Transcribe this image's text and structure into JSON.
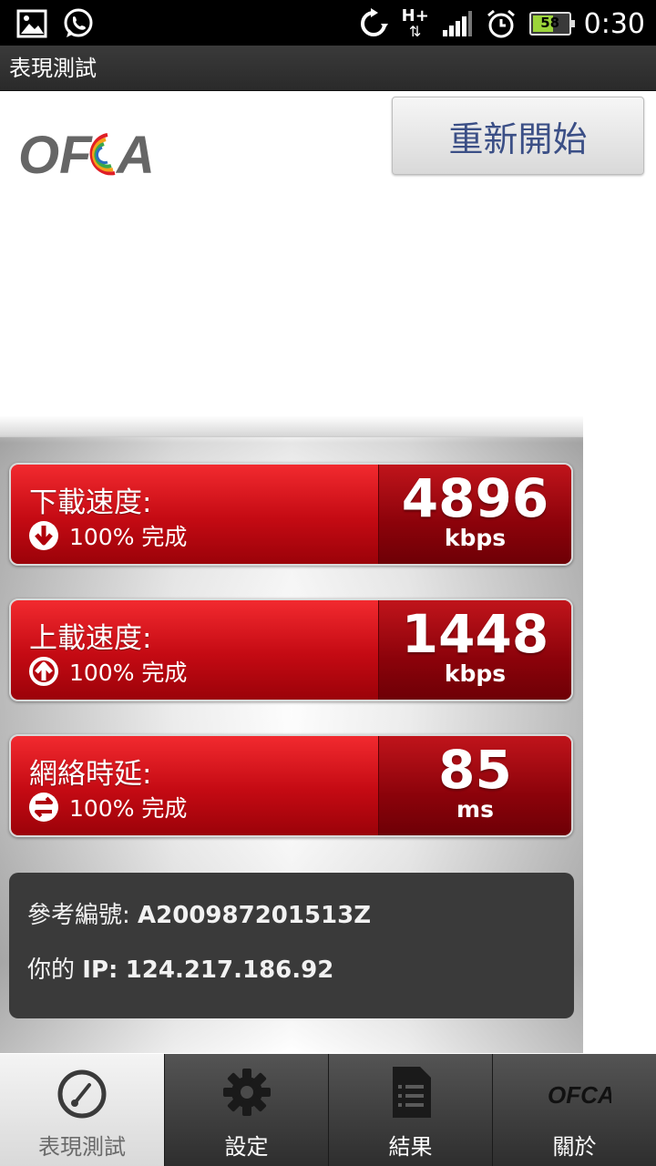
{
  "status_bar": {
    "network_type": "H+",
    "battery_level": "58",
    "battery_fraction": 0.58,
    "time": "0:30"
  },
  "title_bar": {
    "title": "表現測試"
  },
  "header": {
    "logo_text": "OFCA",
    "restart_label": "重新開始"
  },
  "metrics": [
    {
      "label": "下載速度:",
      "status": "100% 完成",
      "value": "4896",
      "unit": "kbps",
      "icon": "download-arrow-icon"
    },
    {
      "label": "上載速度:",
      "status": "100% 完成",
      "value": "1448",
      "unit": "kbps",
      "icon": "upload-arrow-icon"
    },
    {
      "label": "網絡時延:",
      "status": "100% 完成",
      "value": "85",
      "unit": "ms",
      "icon": "latency-exchange-icon"
    }
  ],
  "info": {
    "ref_label": "參考編號:",
    "ref_value": "A200987201513Z",
    "ip_label": "你的",
    "ip_key": "IP:",
    "ip_value": "124.217.186.92"
  },
  "tabs": [
    {
      "label": "表現測試",
      "icon": "speedometer-icon",
      "active": true
    },
    {
      "label": "設定",
      "icon": "gear-icon",
      "active": false
    },
    {
      "label": "結果",
      "icon": "document-list-icon",
      "active": false
    },
    {
      "label": "關於",
      "icon": "ofca-logo-icon",
      "active": false
    }
  ],
  "colors": {
    "metric_red": "#d0121a",
    "metric_dark_red": "#7a0008",
    "restart_text": "#3b4f86",
    "info_bg": "#3a3a3a"
  }
}
